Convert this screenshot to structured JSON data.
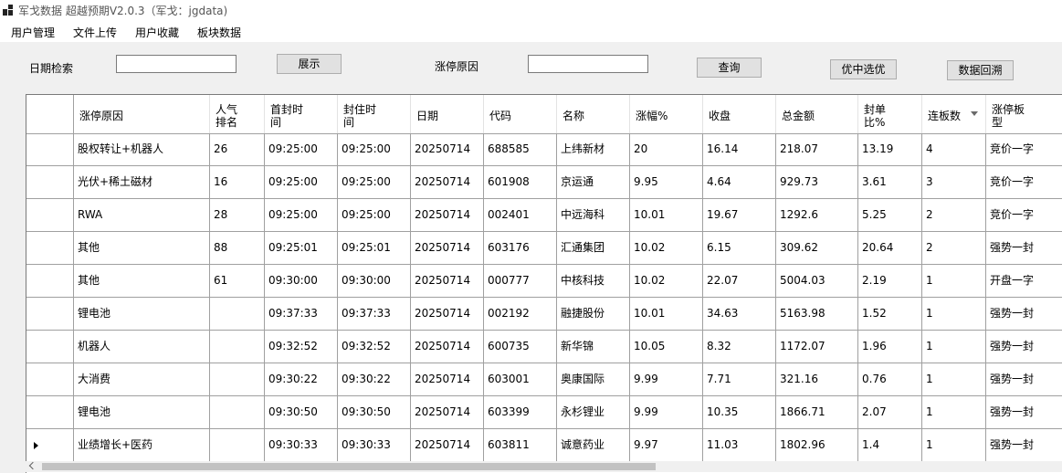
{
  "window": {
    "title": "军戈数据 超越预期V2.0.3（军戈：jgdata)"
  },
  "menu": [
    "用户管理",
    "文件上传",
    "用户收藏",
    "板块数据"
  ],
  "toolbar": {
    "date_label": "日期检索",
    "date_value": "",
    "show_button": "展示",
    "reason_label": "涨停原因",
    "reason_value": "",
    "query_button": "查询",
    "select_button": "优中选优",
    "backtrack_button": "数据回溯"
  },
  "table": {
    "columns": [
      {
        "l1": "涨停原因",
        "l2": ""
      },
      {
        "l1": "人气",
        "l2": "排名"
      },
      {
        "l1": "首封时",
        "l2": "间"
      },
      {
        "l1": "封住时",
        "l2": "间"
      },
      {
        "l1": "日期",
        "l2": ""
      },
      {
        "l1": "代码",
        "l2": ""
      },
      {
        "l1": "名称",
        "l2": ""
      },
      {
        "l1": "涨幅%",
        "l2": ""
      },
      {
        "l1": "收盘",
        "l2": ""
      },
      {
        "l1": "总金额",
        "l2": ""
      },
      {
        "l1": "封单",
        "l2": "比%"
      },
      {
        "l1": "连板数",
        "l2": ""
      },
      {
        "l1": "涨停板",
        "l2": "型"
      }
    ],
    "rows": [
      [
        "股权转让+机器人",
        "26",
        "09:25:00",
        "09:25:00",
        "20250714",
        "688585",
        "上纬新材",
        "20",
        "16.14",
        "218.07",
        "13.19",
        "4",
        "竞价一字"
      ],
      [
        "光伏+稀土磁材",
        "16",
        "09:25:00",
        "09:25:00",
        "20250714",
        "601908",
        "京运通",
        "9.95",
        "4.64",
        "929.73",
        "3.61",
        "3",
        "竞价一字"
      ],
      [
        "RWA",
        "28",
        "09:25:00",
        "09:25:00",
        "20250714",
        "002401",
        "中远海科",
        "10.01",
        "19.67",
        "1292.6",
        "5.25",
        "2",
        "竞价一字"
      ],
      [
        "其他",
        "88",
        "09:25:01",
        "09:25:01",
        "20250714",
        "603176",
        "汇通集团",
        "10.02",
        "6.15",
        "309.62",
        "20.64",
        "2",
        "强势一封"
      ],
      [
        "其他",
        "61",
        "09:30:00",
        "09:30:00",
        "20250714",
        "000777",
        "中核科技",
        "10.02",
        "22.07",
        "5004.03",
        "2.19",
        "1",
        "开盘一字"
      ],
      [
        "锂电池",
        "",
        "09:37:33",
        "09:37:33",
        "20250714",
        "002192",
        "融捷股份",
        "10.01",
        "34.63",
        "5163.98",
        "1.52",
        "1",
        "强势一封"
      ],
      [
        "机器人",
        "",
        "09:32:52",
        "09:32:52",
        "20250714",
        "600735",
        "新华锦",
        "10.05",
        "8.32",
        "1172.07",
        "1.96",
        "1",
        "强势一封"
      ],
      [
        "大消费",
        "",
        "09:30:22",
        "09:30:22",
        "20250714",
        "603001",
        "奥康国际",
        "9.99",
        "7.71",
        "321.16",
        "0.76",
        "1",
        "强势一封"
      ],
      [
        "锂电池",
        "",
        "09:30:50",
        "09:30:50",
        "20250714",
        "603399",
        "永杉锂业",
        "9.99",
        "10.35",
        "1866.71",
        "2.07",
        "1",
        "强势一封"
      ],
      [
        "业绩增长+医药",
        "",
        "09:30:33",
        "09:30:33",
        "20250714",
        "603811",
        "诚意药业",
        "9.97",
        "11.03",
        "1802.96",
        "1.4",
        "1",
        "强势一封"
      ]
    ],
    "current_row": 9
  }
}
